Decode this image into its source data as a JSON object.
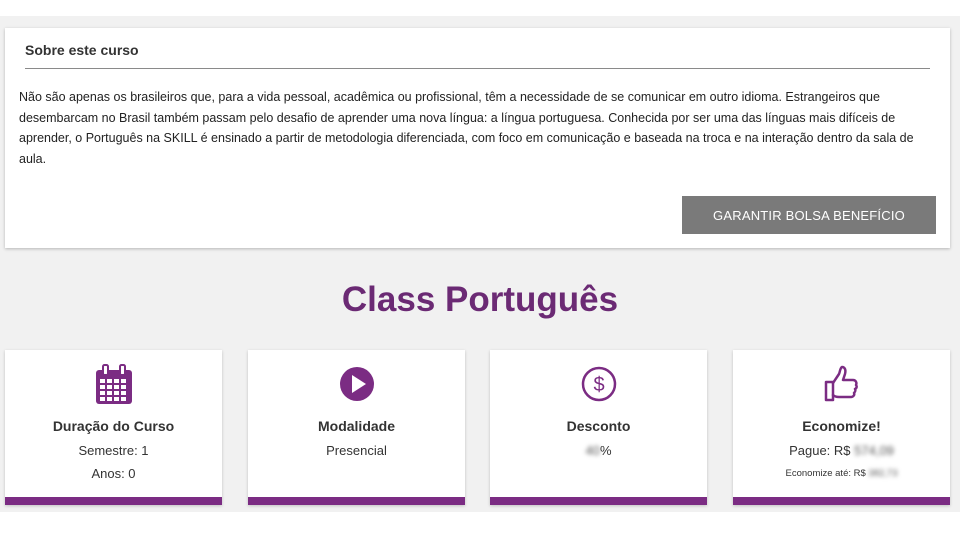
{
  "colors": {
    "accent": "#7b2c83",
    "title": "#6b2a74",
    "button": "#7a7a7a",
    "background": "#f1f1f1"
  },
  "about": {
    "heading": "Sobre este curso",
    "text": "Não são apenas os brasileiros que, para a vida pessoal, acadêmica ou profissional, têm a necessidade de se comunicar em outro idioma. Estrangeiros que desembarcam no Brasil também passam pelo desafio de aprender uma nova língua: a língua portuguesa. Conhecida por ser uma das línguas mais difíceis de aprender, o Português na SKILL é ensinado a partir de metodologia diferenciada, com foco em comunicação e baseada na troca e na interação dentro da sala de aula.",
    "button_label": "GARANTIR BOLSA BENEFÍCIO"
  },
  "course": {
    "title": "Class Português"
  },
  "cards": {
    "duration": {
      "icon": "calendar-icon",
      "title": "Duração do Curso",
      "line1": "Semestre: 1",
      "line2": "Anos: 0"
    },
    "modality": {
      "icon": "play-circle-icon",
      "title": "Modalidade",
      "line1": "Presencial"
    },
    "discount": {
      "icon": "dollar-circle-icon",
      "title": "Desconto",
      "value": "40",
      "suffix": "%"
    },
    "savings": {
      "icon": "thumbs-up-icon",
      "title": "Economize!",
      "pay_label": "Pague: R$",
      "pay_value": "574,09",
      "save_label": "Economize até: R$",
      "save_value": "382,73"
    }
  }
}
